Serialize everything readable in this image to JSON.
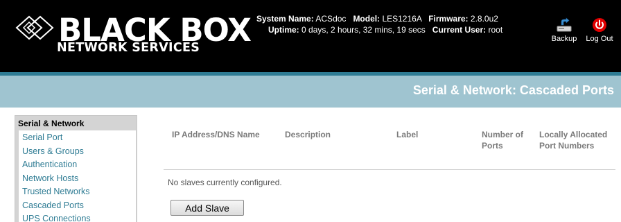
{
  "brand": {
    "name": "BLACK BOX",
    "registered": "®",
    "subtitle": "NETWORK SERVICES"
  },
  "system_info": {
    "system_name_label": "System Name:",
    "system_name": "ACSdoc",
    "model_label": "Model:",
    "model": "LES1216A",
    "firmware_label": "Firmware:",
    "firmware": "2.8.0u2",
    "uptime_label": "Uptime:",
    "uptime": "0 days, 2 hours, 32 mins, 19 secs",
    "current_user_label": "Current User:",
    "current_user": "root"
  },
  "header_actions": {
    "backup_label": "Backup",
    "backup_icon": "backup-drive-icon",
    "logout_label": "Log Out",
    "logout_icon": "power-icon"
  },
  "page_title": "Serial & Network: Cascaded Ports",
  "sidebar": {
    "title": "Serial & Network",
    "items": [
      {
        "label": "Serial Port"
      },
      {
        "label": "Users & Groups"
      },
      {
        "label": "Authentication"
      },
      {
        "label": "Network Hosts"
      },
      {
        "label": "Trusted Networks"
      },
      {
        "label": "Cascaded Ports"
      },
      {
        "label": "UPS Connections"
      }
    ]
  },
  "table": {
    "columns": [
      "IP Address/DNS Name",
      "Description",
      "Label",
      "Number of Ports",
      "Locally Allocated Port Numbers"
    ],
    "empty_message": "No slaves currently configured."
  },
  "actions": {
    "add_slave_label": "Add Slave"
  },
  "colors": {
    "header_bg": "#000000",
    "accent_teal": "#2f7c94",
    "title_band": "#9fc4d0",
    "sidebar_bg": "#d4d4d4",
    "logout_red": "#e00000"
  }
}
